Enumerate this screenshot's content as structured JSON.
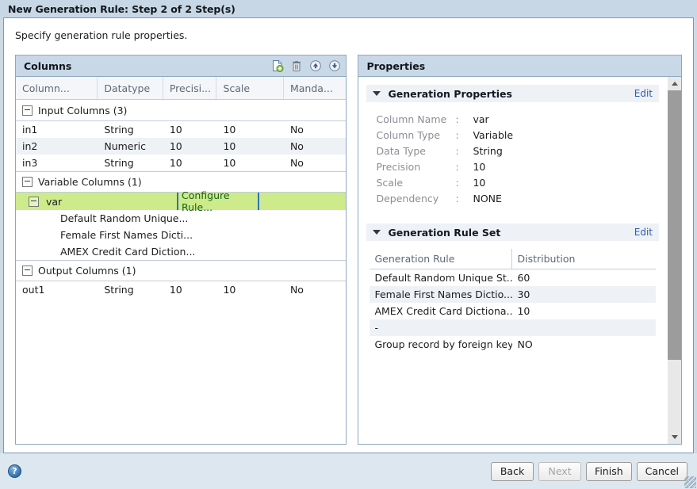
{
  "window": {
    "title": "New Generation Rule: Step 2 of 2 Step(s)",
    "instruction": "Specify generation rule properties."
  },
  "columns_panel": {
    "title": "Columns",
    "tools": [
      {
        "name": "add-column-icon",
        "label": "Add"
      },
      {
        "name": "delete-column-icon",
        "label": "Delete"
      },
      {
        "name": "move-up-icon",
        "label": "Move Up"
      },
      {
        "name": "move-down-icon",
        "label": "Move Down"
      }
    ],
    "headers": [
      "Column...",
      "Datatype",
      "Precisi...",
      "Scale",
      "Manda..."
    ],
    "groups": [
      {
        "label": "Input Columns (3)",
        "rows": [
          {
            "column": "in1",
            "datatype": "String",
            "precision": "10",
            "scale": "10",
            "mandatory": "No"
          },
          {
            "column": "in2",
            "datatype": "Numeric",
            "precision": "10",
            "scale": "10",
            "mandatory": "No"
          },
          {
            "column": "in3",
            "datatype": "String",
            "precision": "10",
            "scale": "10",
            "mandatory": "No"
          }
        ]
      },
      {
        "label": "Variable Columns (1)",
        "variable": {
          "name": "var",
          "configure_label": "Configure Rule...",
          "children": [
            "Default Random Unique...",
            "Female First Names Dicti...",
            "AMEX Credit Card Diction..."
          ]
        }
      },
      {
        "label": "Output Columns (1)",
        "rows": [
          {
            "column": "out1",
            "datatype": "String",
            "precision": "10",
            "scale": "10",
            "mandatory": "No"
          }
        ]
      }
    ]
  },
  "properties_panel": {
    "title": "Properties",
    "generation_properties": {
      "title": "Generation Properties",
      "edit_label": "Edit",
      "fields": [
        {
          "key": "Column Name",
          "sep": ":",
          "value": "var"
        },
        {
          "key": "Column Type",
          "sep": ":",
          "value": "Variable"
        },
        {
          "key": "Data Type",
          "sep": ":",
          "value": "String"
        },
        {
          "key": "Precision",
          "sep": ":",
          "value": "10"
        },
        {
          "key": "Scale",
          "sep": ":",
          "value": "10"
        },
        {
          "key": "Dependency",
          "sep": ":",
          "value": "NONE"
        }
      ]
    },
    "generation_rule_set": {
      "title": "Generation Rule Set",
      "edit_label": "Edit",
      "headers": [
        "Generation Rule",
        "Distribution"
      ],
      "rows": [
        {
          "rule": "Default Random Unique St...",
          "distribution": "60"
        },
        {
          "rule": "Female First Names Dictio...",
          "distribution": "30"
        },
        {
          "rule": "AMEX Credit Card Dictiona...",
          "distribution": "10"
        },
        {
          "rule": "-",
          "distribution": ""
        },
        {
          "rule": "Group record by foreign key",
          "distribution": "NO"
        }
      ]
    }
  },
  "footer": {
    "help_glyph": "?",
    "buttons": [
      {
        "label": "Back",
        "disabled": false
      },
      {
        "label": "Next",
        "disabled": true
      },
      {
        "label": "Finish",
        "disabled": false
      },
      {
        "label": "Cancel",
        "disabled": false
      }
    ]
  },
  "colors": {
    "titlebar": "#c7d7e5",
    "panel_header": "#c9d8e6",
    "selection_green": "#cdeb8b",
    "edit_link": "#2a5db0",
    "row_alt": "#eef2f7"
  }
}
